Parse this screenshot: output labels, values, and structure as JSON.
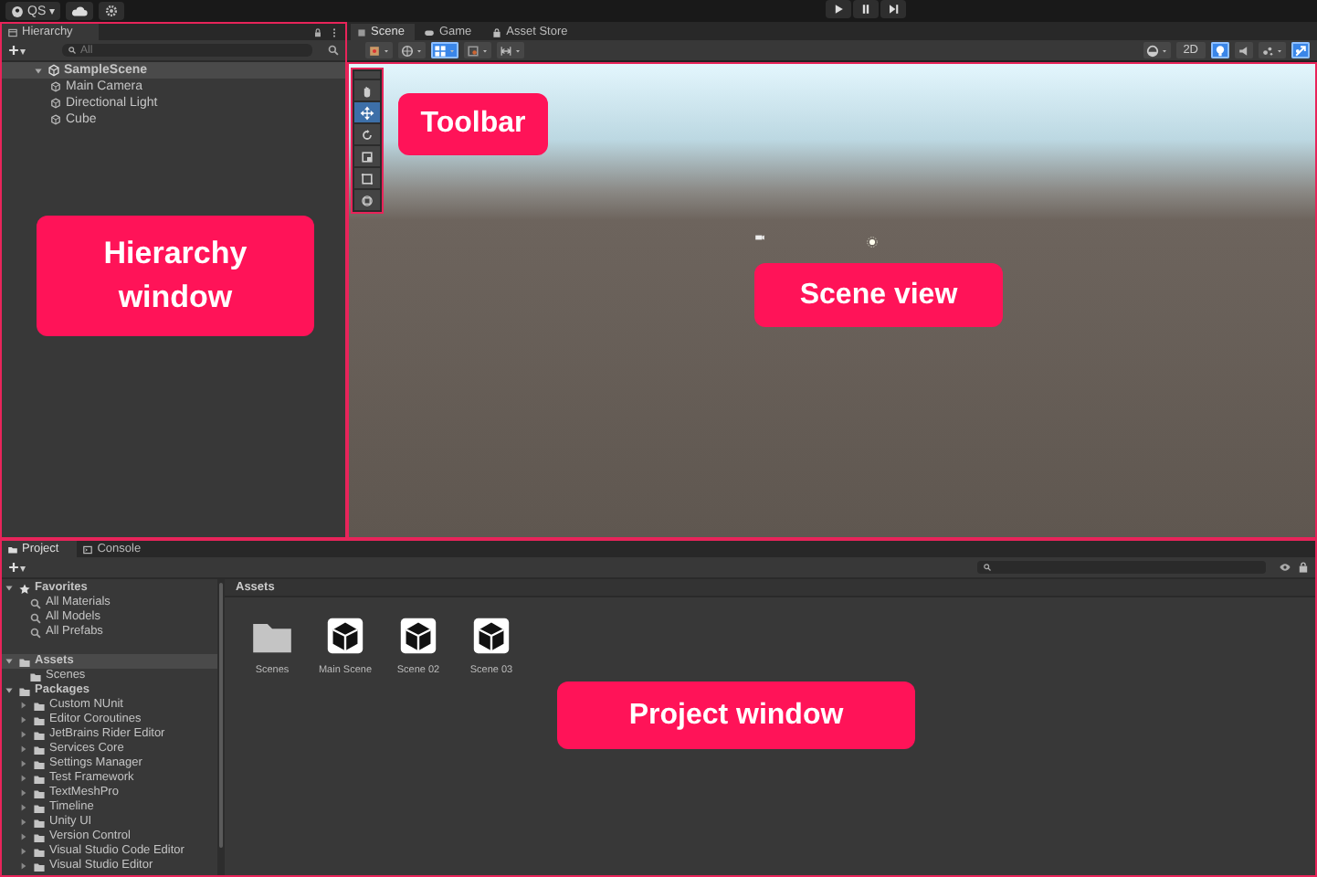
{
  "top_bar": {
    "account": "QS",
    "account_caret": "▾"
  },
  "hierarchy": {
    "title": "Hierarchy",
    "add_caret": "▾",
    "search_placeholder": "All",
    "items": [
      {
        "label": "SampleScene",
        "selected": true,
        "expanded": true,
        "children": [
          {
            "label": "Main Camera",
            "selected": false
          },
          {
            "label": "Directional Light",
            "selected": false
          },
          {
            "label": "Cube",
            "selected": false
          }
        ]
      }
    ],
    "callout": "Hierarchy window"
  },
  "scene": {
    "tabs": [
      {
        "label": "Scene",
        "kind": "scene",
        "selected": true
      },
      {
        "label": "Game",
        "kind": "game",
        "selected": false
      },
      {
        "label": "Asset Store",
        "kind": "store",
        "selected": false
      }
    ],
    "left_toggles": [
      {
        "kind": "pivot",
        "on": false
      },
      {
        "kind": "global",
        "on": false
      },
      {
        "kind": "grid",
        "on": true
      },
      {
        "kind": "snap",
        "on": false
      },
      {
        "kind": "increment",
        "on": false
      }
    ],
    "mode_2d": {
      "label": "2D",
      "on": false
    },
    "right_toggles": [
      {
        "kind": "lighting",
        "on": true
      },
      {
        "kind": "audio",
        "on": false
      },
      {
        "kind": "effects",
        "on": false
      },
      {
        "kind": "gizmos",
        "on": true
      }
    ],
    "tools": [
      {
        "kind": "hand",
        "selected": false
      },
      {
        "kind": "move",
        "selected": true
      },
      {
        "kind": "rotate",
        "selected": false
      },
      {
        "kind": "scale",
        "selected": false
      },
      {
        "kind": "rect",
        "selected": false
      },
      {
        "kind": "transform",
        "selected": false
      }
    ],
    "toolbar_callout": "Toolbar",
    "callout": "Scene view"
  },
  "project": {
    "tabs": [
      {
        "label": "Project",
        "kind": "project",
        "selected": true
      },
      {
        "label": "Console",
        "kind": "console",
        "selected": false
      }
    ],
    "add_caret": "▾",
    "tree": [
      {
        "label": "Favorites",
        "kind": "favorites",
        "selected": false,
        "expanded": true,
        "children": [
          {
            "label": "All Materials",
            "kind": "search",
            "selected": false
          },
          {
            "label": "All Models",
            "kind": "search",
            "selected": false
          },
          {
            "label": "All Prefabs",
            "kind": "search",
            "selected": false
          }
        ]
      },
      {
        "label": "Assets",
        "kind": "folder",
        "selected": true,
        "expanded": true,
        "children": [
          {
            "label": "Scenes",
            "kind": "folder",
            "selected": false
          }
        ]
      },
      {
        "label": "Packages",
        "kind": "folder",
        "selected": false,
        "expanded": true,
        "children": [
          {
            "label": "Custom NUnit",
            "kind": "folder",
            "selected": false,
            "expanded": false
          },
          {
            "label": "Editor Coroutines",
            "kind": "folder",
            "selected": false,
            "expanded": false
          },
          {
            "label": "JetBrains Rider Editor",
            "kind": "folder",
            "selected": false,
            "expanded": false
          },
          {
            "label": "Services Core",
            "kind": "folder",
            "selected": false,
            "expanded": false
          },
          {
            "label": "Settings Manager",
            "kind": "folder",
            "selected": false,
            "expanded": false
          },
          {
            "label": "Test Framework",
            "kind": "folder",
            "selected": false,
            "expanded": false
          },
          {
            "label": "TextMeshPro",
            "kind": "folder",
            "selected": false,
            "expanded": false
          },
          {
            "label": "Timeline",
            "kind": "folder",
            "selected": false,
            "expanded": false
          },
          {
            "label": "Unity UI",
            "kind": "folder",
            "selected": false,
            "expanded": false
          },
          {
            "label": "Version Control",
            "kind": "folder",
            "selected": false,
            "expanded": false
          },
          {
            "label": "Visual Studio Code Editor",
            "kind": "folder",
            "selected": false,
            "expanded": false
          },
          {
            "label": "Visual Studio Editor",
            "kind": "folder",
            "selected": false,
            "expanded": false
          }
        ]
      }
    ],
    "breadcrumb": "Assets",
    "assets": [
      {
        "label": "Scenes",
        "kind": "folder",
        "selected": false
      },
      {
        "label": "Main Scene",
        "kind": "scene",
        "selected": false
      },
      {
        "label": "Scene 02",
        "kind": "scene",
        "selected": false
      },
      {
        "label": "Scene 03",
        "kind": "scene",
        "selected": false
      }
    ],
    "callout": "Project window"
  }
}
